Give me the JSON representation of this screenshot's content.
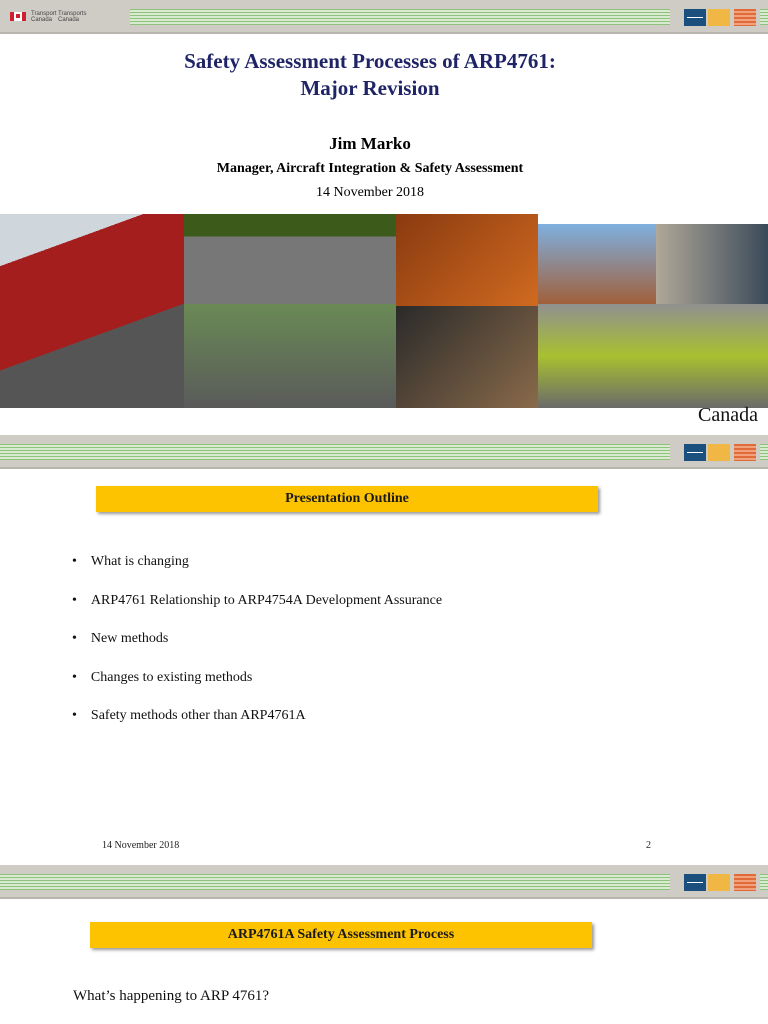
{
  "header": {
    "org_en": [
      "Transport",
      "Canada"
    ],
    "org_fr": [
      "Transports",
      "Canada"
    ]
  },
  "slide1": {
    "title_line1": "Safety Assessment Processes of ARP4761:",
    "title_line2": "Major Revision",
    "presenter": "Jim Marko",
    "role": "Manager,  Aircraft Integration & Safety Assessment",
    "date": "14 November 2018",
    "wordmark": "Canada"
  },
  "slide2": {
    "heading": "Presentation Outline",
    "bullets": [
      "What is changing",
      "ARP4761 Relationship to ARP4754A Development Assurance",
      "New methods",
      "Changes to existing methods",
      "Safety methods other than ARP4761A"
    ],
    "footer_date": "14 November 2018",
    "page_number": "2"
  },
  "slide3": {
    "heading": "ARP4761A Safety Assessment Process",
    "subtitle": "What’s happening to ARP 4761?"
  }
}
